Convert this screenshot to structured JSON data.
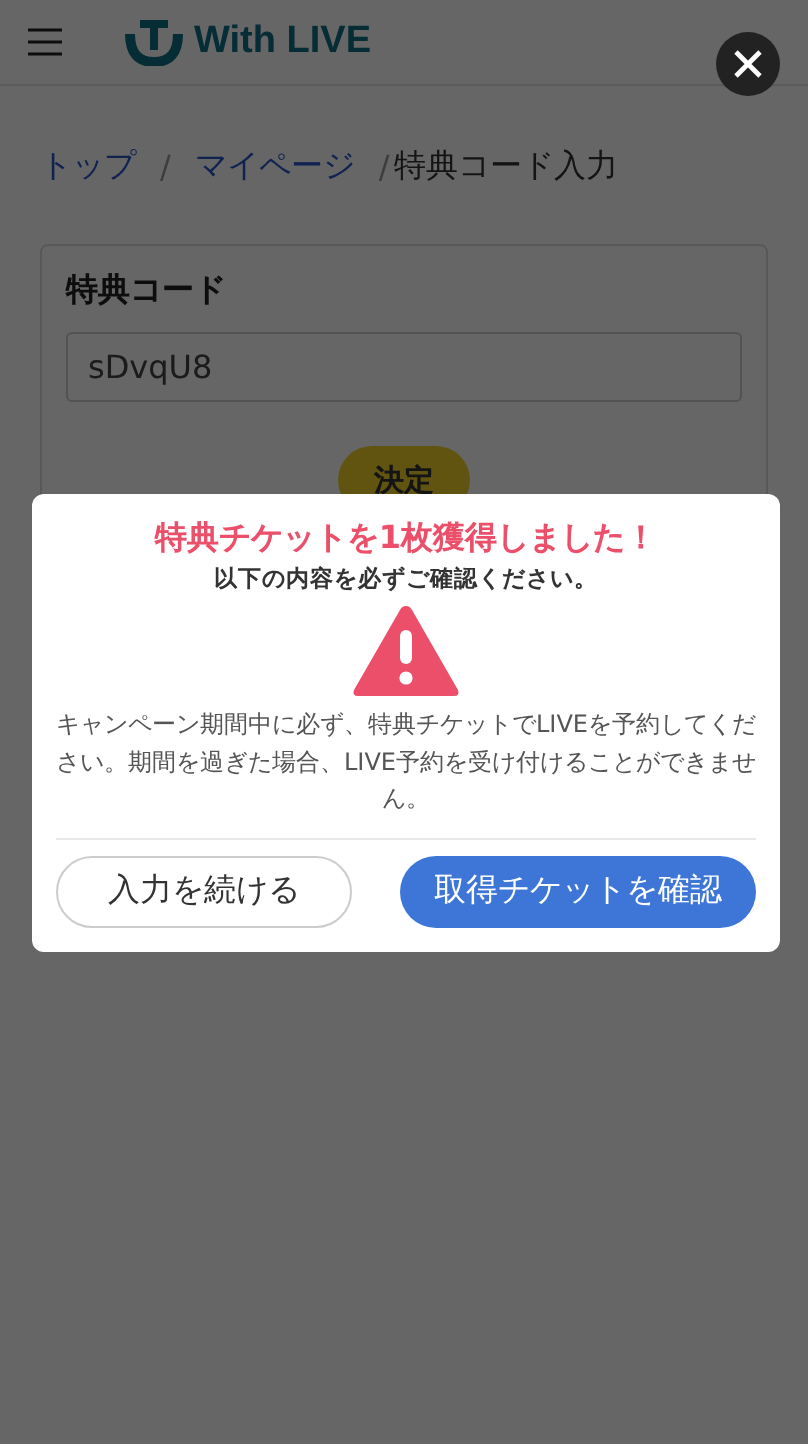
{
  "header": {
    "logo_text": "With LIVE"
  },
  "breadcrumbs": {
    "separator": "/",
    "items": [
      {
        "label": "トップ",
        "kind": "link"
      },
      {
        "label": "マイページ",
        "kind": "link"
      },
      {
        "label": "特典コード入力",
        "kind": "current"
      }
    ]
  },
  "form": {
    "label": "特典コード",
    "value": "sDvqU8",
    "submit": "決定"
  },
  "dialog": {
    "title": "特典チケットを1枚獲得しました！",
    "subtitle": "以下の内容を必ずご確認ください。",
    "message": "キャンペーン期間中に必ず、特典チケットでLIVEを予約してください。期間を過ぎた場合、LIVE予約を受け付けることができません。",
    "buttons": [
      {
        "label": "入力を続ける",
        "kind": "secondary"
      },
      {
        "label": "取得チケットを確認",
        "kind": "primary"
      }
    ]
  }
}
